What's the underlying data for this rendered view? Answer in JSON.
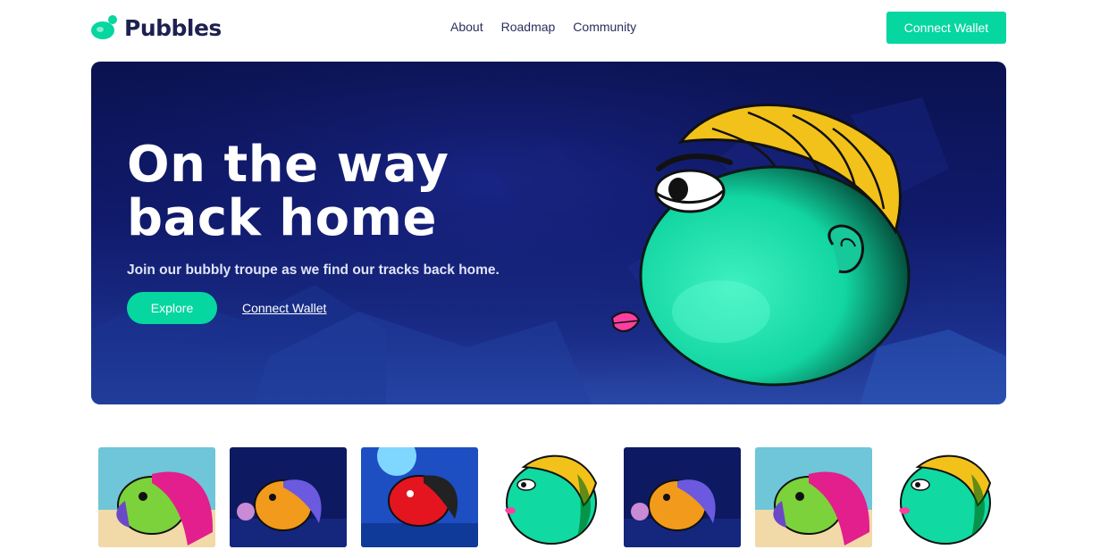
{
  "brand": {
    "name": "Pubbles",
    "accent": "#06d6a0",
    "dark": "#1e2150"
  },
  "nav": {
    "items": [
      "About",
      "Roadmap",
      "Community"
    ]
  },
  "header": {
    "cta_label": "Connect Wallet"
  },
  "hero": {
    "title": "On the way back home",
    "subtitle": "Join our bubbly troupe as we find our tracks back home.",
    "explore_label": "Explore",
    "connect_label": "Connect Wallet"
  },
  "gallery": {
    "thumbnails": [
      {
        "theme": "beach-pink-braids-fish"
      },
      {
        "theme": "deep-sea-orange-fish"
      },
      {
        "theme": "moonlit-red-fish"
      },
      {
        "theme": "blonde-green-fish"
      },
      {
        "theme": "deep-sea-orange-fish"
      },
      {
        "theme": "beach-pink-braids-fish"
      },
      {
        "theme": "blonde-green-fish"
      }
    ]
  }
}
